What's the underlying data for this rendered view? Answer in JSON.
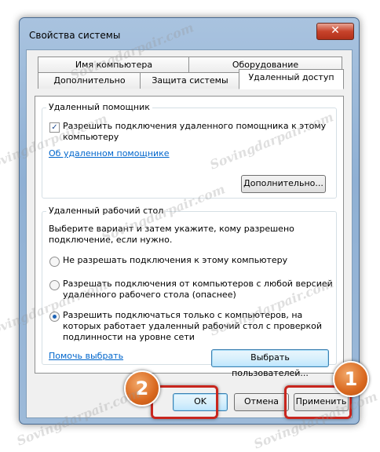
{
  "window": {
    "title": "Свойства системы",
    "close_glyph": "✕"
  },
  "tabs_row_top": [
    {
      "label": "Имя компьютера"
    },
    {
      "label": "Оборудование"
    }
  ],
  "tabs_row_bottom": [
    {
      "label": "Дополнительно"
    },
    {
      "label": "Защита системы"
    },
    {
      "label": "Удаленный доступ",
      "active": true
    }
  ],
  "remote_assistance": {
    "group_label": "Удаленный помощник",
    "checkbox_line1": "Разрешить подключения удаленного помощника к этому",
    "checkbox_line2": "компьютеру",
    "checkbox_checked": true,
    "link": "Об удаленном помощнике",
    "advanced_button": "Дополнительно..."
  },
  "remote_desktop": {
    "group_label": "Удаленный рабочий стол",
    "intro_line1": "Выберите вариант и затем укажите, кому разрешено",
    "intro_line2": "подключение, если нужно.",
    "options": [
      {
        "lines": [
          "Не разрешать подключения к этому компьютеру"
        ],
        "checked": false
      },
      {
        "lines": [
          "Разрешать подключения от компьютеров с любой версией",
          "удаленного рабочего стола (опаснее)"
        ],
        "checked": false
      },
      {
        "lines": [
          "Разрешить подключаться только с компьютеров, на",
          "которых работает удаленный рабочий стол с проверкой",
          "подлинности на уровне сети"
        ],
        "checked": true
      }
    ],
    "help_link": "Помочь выбрать",
    "select_users_button": "Выбрать пользователей..."
  },
  "footer": {
    "ok_button": "OK",
    "cancel_button": "Отмена",
    "apply_button": "Применить"
  },
  "annotations": {
    "badge_ok": "2",
    "badge_apply": "1"
  },
  "watermark": "Sovingdarpair.com",
  "colors": {
    "link": "#0066cc",
    "highlight": "#c8261e",
    "badge": "#d9681f"
  }
}
